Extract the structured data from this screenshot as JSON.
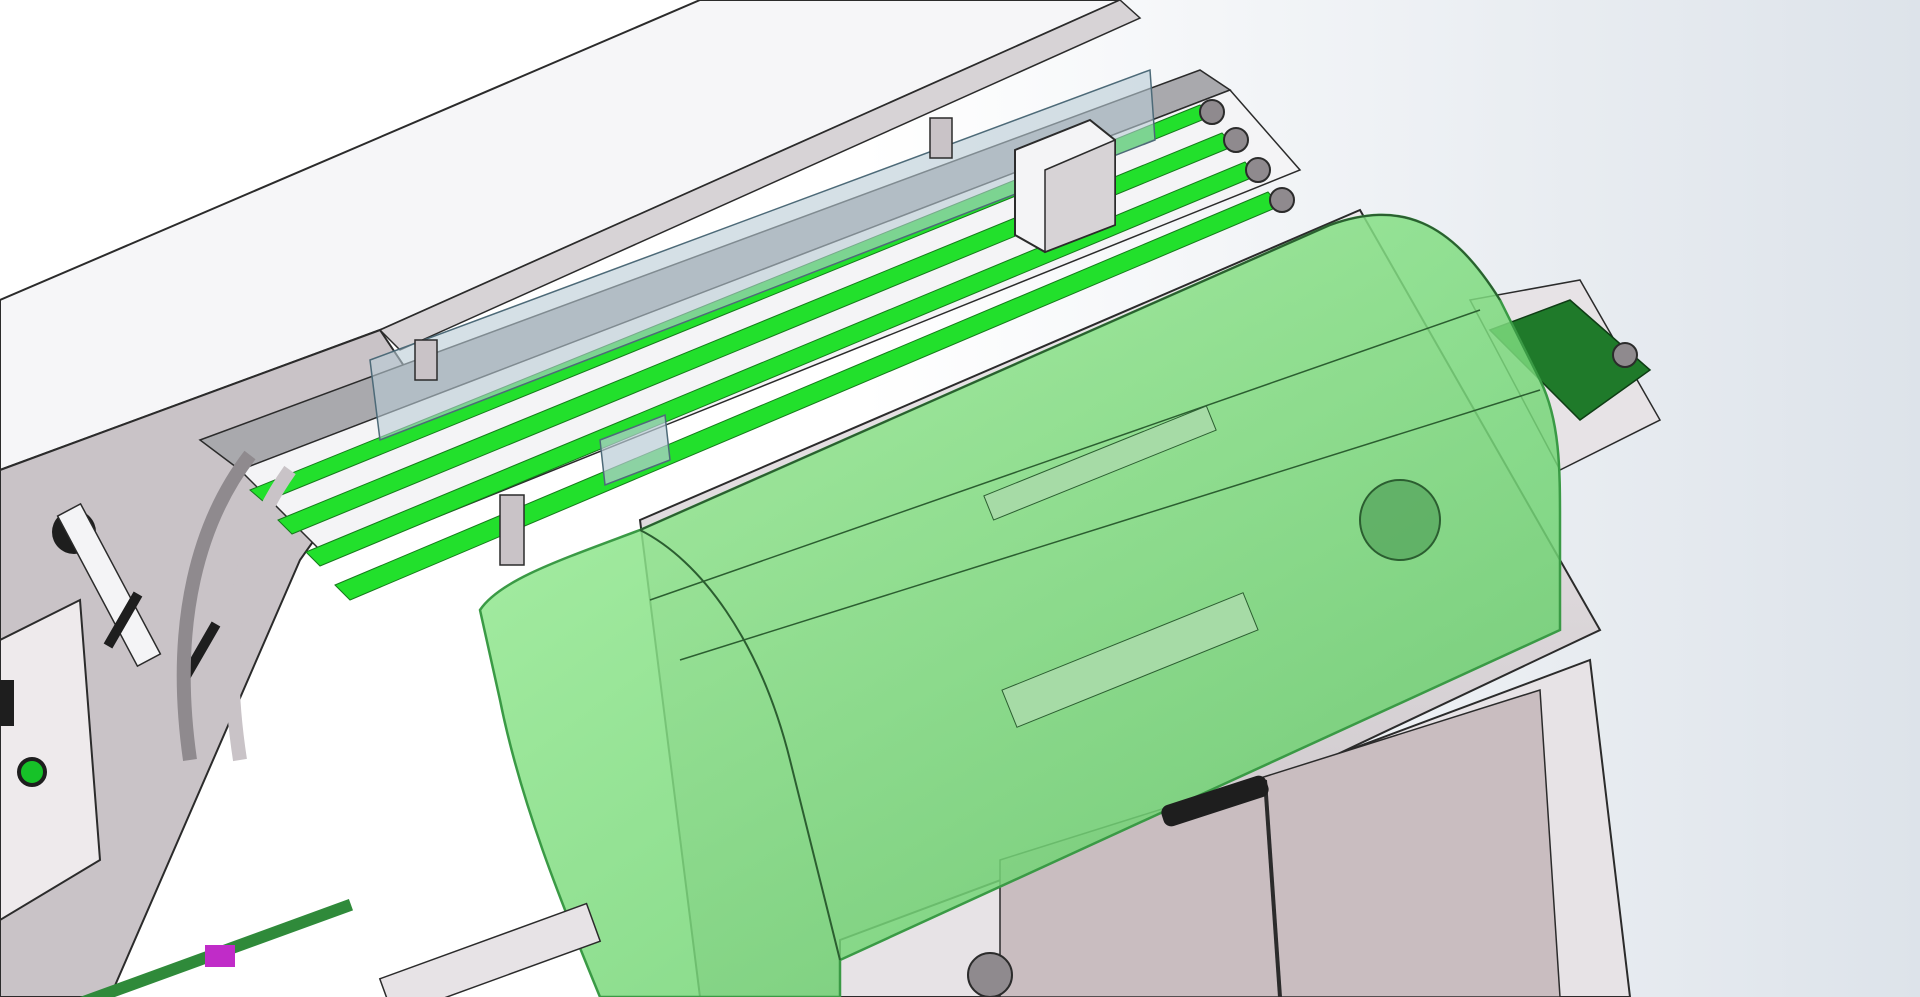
{
  "scene": {
    "subject": "",
    "colors": {
      "background_light": "#ffffff",
      "background_grad": "#dde3ea",
      "frame_light": "#e7e3e6",
      "frame_mid": "#c9c3c7",
      "frame_dark": "#8f8a8e",
      "rail_gray": "#a9a9ad",
      "belt_green": "#22e02c",
      "belt_dark_green": "#1f7a2a",
      "guard_green": "#7fe07f",
      "guard_green_edge": "#3a9a45",
      "glass_blue": "#b9ccd6",
      "panel_white": "#f4f4f6",
      "knob_black": "#1e1e1e",
      "button_green": "#16c228",
      "accent_magenta": "#c02cc8",
      "outline": "#2b2b2b"
    }
  }
}
